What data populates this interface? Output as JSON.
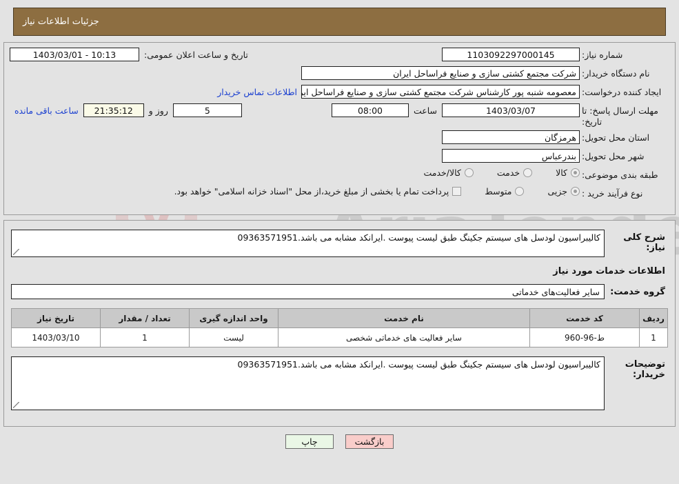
{
  "header": {
    "title": "جزئیات اطلاعات نیاز"
  },
  "colors": {
    "header_bar": "#8d6e41",
    "page_background": "#e3e3e3",
    "link": "#1a3fd0",
    "countdown_bg": "#fbfbe8",
    "back_button_bg": "#f9cdca",
    "print_button_bg": "#eaf7e6",
    "table_header_bg": "#c9c9c9"
  },
  "form": {
    "need_number": {
      "label": "شماره نیاز:",
      "value": "1103092297000145"
    },
    "announcement": {
      "label": "تاریخ و ساعت اعلان عمومی:",
      "value": "1403/03/01 - 10:13"
    },
    "buyer_org": {
      "label": "نام دستگاه خریدار:",
      "value": "شرکت مجتمع کشتی سازی و صنایع فراساحل ایران"
    },
    "requester": {
      "label": "ایجاد کننده درخواست:",
      "value": "معصومه شنبه پور کارشناس شرکت مجتمع کشتی سازی و صنایع فراساحل ایران",
      "contact_link": "اطلاعات تماس خریدار"
    },
    "deadline": {
      "label": "مهلت ارسال پاسخ: تا تاریخ:",
      "date": "1403/03/07",
      "hour_label": "ساعت",
      "hour": "08:00",
      "days": "5",
      "days_label": "روز و",
      "countdown": "21:35:12",
      "remaining_label": "ساعت باقی مانده"
    },
    "province": {
      "label": "استان محل تحویل:",
      "value": "هرمزگان"
    },
    "city": {
      "label": "شهر محل تحویل:",
      "value": "بندرعباس"
    },
    "category": {
      "label": "طبقه بندی موضوعی:",
      "options": [
        {
          "label": "کالا",
          "selected": true
        },
        {
          "label": "خدمت",
          "selected": false
        },
        {
          "label": "کالا/خدمت",
          "selected": false
        }
      ]
    },
    "purchase_process": {
      "label": "نوع فرآیند خرید :",
      "options": [
        {
          "label": "جزیی",
          "selected": true
        },
        {
          "label": "متوسط",
          "selected": false
        }
      ],
      "checkbox_note": "پرداخت تمام یا بخشی از مبلغ خرید،از محل \"اسناد خزانه اسلامی\" خواهد بود.",
      "checkbox_checked": false
    }
  },
  "body": {
    "general_description": {
      "label": "شرح کلی نیاز:",
      "value": "کالیبراسیون لودسل های سیستم جکینگ طبق لیست پیوست .ایرانکد مشابه می باشد.09363571951"
    },
    "services_heading": "اطلاعات خدمات مورد نیاز",
    "service_group": {
      "label": "گروه خدمت:",
      "value": "سایر فعالیت‌های خدماتی"
    },
    "table": {
      "columns": [
        "ردیف",
        "کد خدمت",
        "نام خدمت",
        "واحد اندازه گیری",
        "تعداد / مقدار",
        "تاریخ نیاز"
      ],
      "rows": [
        {
          "radif": "1",
          "code": "ط-96-960",
          "name": "سایر فعالیت های خدماتی شخصی",
          "unit": "لیست",
          "quantity": "1",
          "date": "1403/03/10"
        }
      ]
    },
    "buyer_comments": {
      "label": "توضیحات خریدار:",
      "value": "کالیبراسیون لودسل های سیستم جکینگ طبق لیست پیوست .ایرانکد مشابه می باشد.09363571951"
    }
  },
  "footer": {
    "back_button": "بازگشت",
    "print_button": "چاپ"
  },
  "watermark": {
    "brand": "AriaTender.net",
    "small": "AriaTender"
  }
}
